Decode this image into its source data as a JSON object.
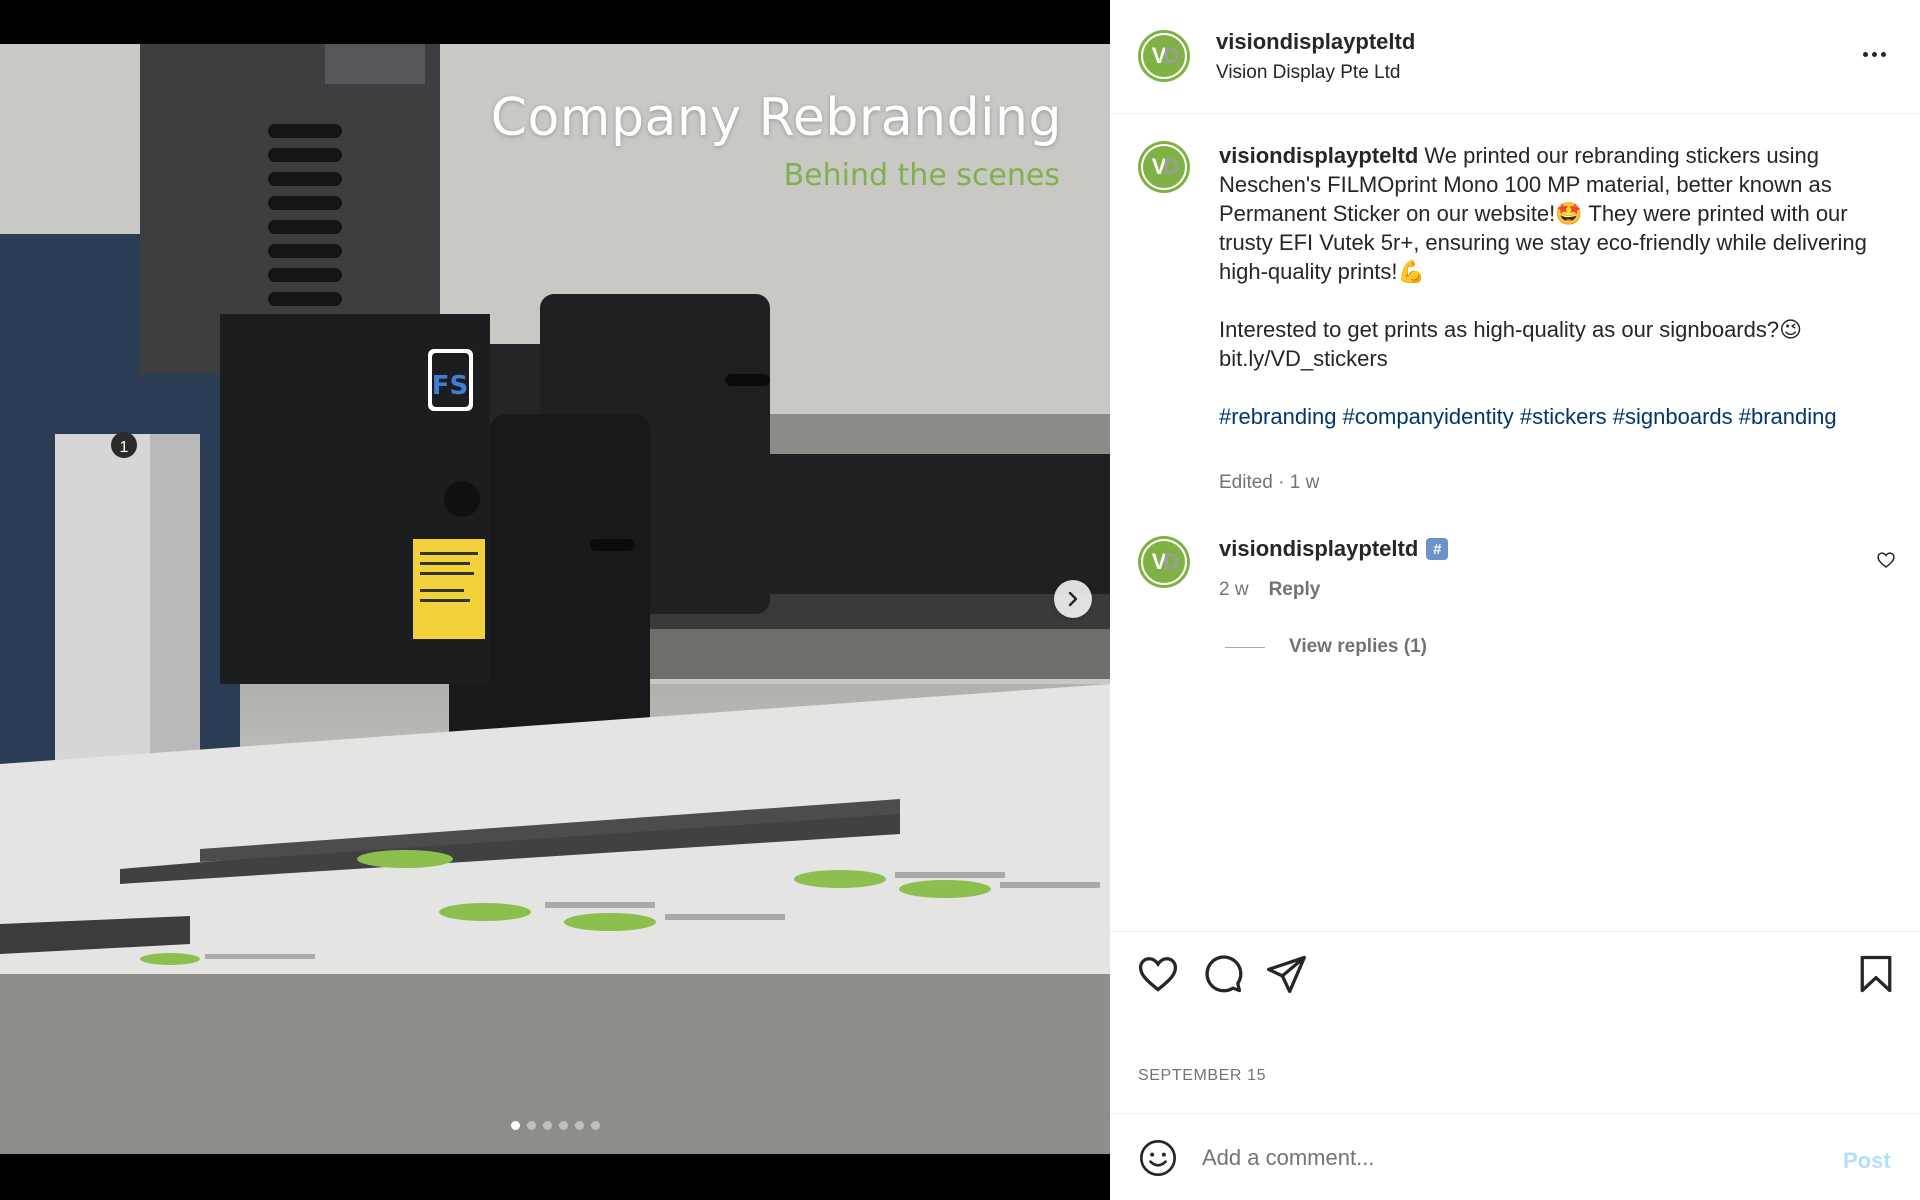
{
  "media": {
    "overlay_title": "Company Rebranding",
    "overlay_subtitle": "Behind the scenes",
    "slide_count": 6,
    "active_slide": 1,
    "printer_badge": "FS",
    "rail_number": "1",
    "colors": {
      "brand_green": "#7fb24b"
    }
  },
  "post": {
    "username": "visiondisplaypteltd",
    "display_name": "Vision Display Pte Ltd",
    "avatar_letters": "VD",
    "caption": {
      "username": "visiondisplaypteltd",
      "text": " We printed our rebranding stickers using Neschen's FILMOprint Mono 100 MP material, better known as Permanent Sticker on our website!🤩 They were printed with our trusty EFI Vutek 5r+, ensuring we stay eco-friendly while delivering high-quality prints!💪",
      "text2": "Interested to get prints as high-quality as our signboards?😉 bit.ly/VD_stickers",
      "hashtags": "#rebranding #companyidentity #stickers #signboards #branding",
      "meta": "Edited · 1 w"
    },
    "comment": {
      "username": "visiondisplaypteltd",
      "badge": "#",
      "time": "2 w",
      "reply_label": "Reply",
      "view_replies": "View replies (1)"
    },
    "date": "SEPTEMBER 15",
    "comment_box": {
      "placeholder": "Add a comment...",
      "post_label": "Post"
    },
    "icons": [
      "more-horizontal-icon",
      "heart-icon",
      "comment-icon",
      "share-icon",
      "bookmark-icon",
      "emoji-icon",
      "chevron-right-icon"
    ]
  }
}
